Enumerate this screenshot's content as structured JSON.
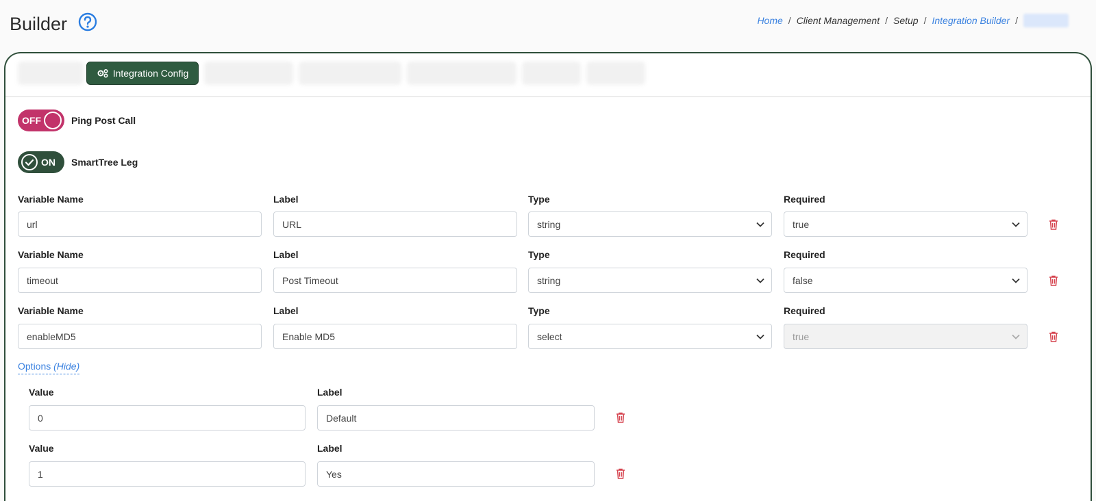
{
  "header": {
    "title": "Builder",
    "breadcrumb": [
      "Home",
      "Client Management",
      "Setup",
      "Integration Builder"
    ]
  },
  "tabs": {
    "active_label": "Integration Config"
  },
  "toggles": [
    {
      "state_text": "OFF",
      "label": "Ping Post Call",
      "color": "#c2336a"
    },
    {
      "state_text": "ON",
      "label": "SmartTree Leg",
      "color": "#2f4f3b"
    }
  ],
  "columns": {
    "variable_name": "Variable Name",
    "label": "Label",
    "type": "Type",
    "required": "Required"
  },
  "variables": [
    {
      "name": "url",
      "label": "URL",
      "type": "string",
      "required": "true"
    },
    {
      "name": "timeout",
      "label": "Post Timeout",
      "type": "string",
      "required": "false"
    },
    {
      "name": "enableMD5",
      "label": "Enable MD5",
      "type": "select",
      "required": "true"
    }
  ],
  "options": {
    "link_text": "Options",
    "toggle_text": "(Hide)",
    "value_label": "Value",
    "label_label": "Label",
    "items": [
      {
        "value": "0",
        "label": "Default"
      },
      {
        "value": "1",
        "label": "Yes"
      }
    ]
  },
  "colors": {
    "accent": "#2f5b40",
    "link": "#3b82e0",
    "danger": "#d64550",
    "off": "#c2336a"
  }
}
